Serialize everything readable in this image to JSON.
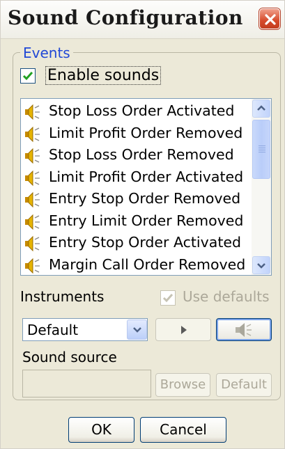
{
  "window": {
    "title": "Sound Configuration"
  },
  "events_group": {
    "legend": "Events",
    "enable_sounds": {
      "label": "Enable sounds",
      "checked": true
    },
    "events": [
      "Stop Loss Order Activated",
      "Limit Profit Order Removed",
      "Stop Loss Order Removed",
      "Limit Profit Order Activated",
      "Entry Stop Order Removed",
      "Entry Limit Order Removed",
      "Entry Stop Order Activated",
      "Margin Call Order Removed"
    ],
    "event_icon": "speaker-icon",
    "instruments_label": "Instruments",
    "use_defaults": {
      "label": "Use defaults",
      "checked": true,
      "enabled": false
    },
    "instrument_select": {
      "value": "Default"
    },
    "sound_source_label": "Sound source",
    "sound_source_value": "",
    "browse_label": "Browse",
    "default_label": "Default"
  },
  "buttons": {
    "ok": "OK",
    "cancel": "Cancel"
  },
  "colors": {
    "legend": "#2148d6",
    "checkmark": "#21a121",
    "speaker": "#e6b400",
    "disabled_text": "#aca899"
  }
}
